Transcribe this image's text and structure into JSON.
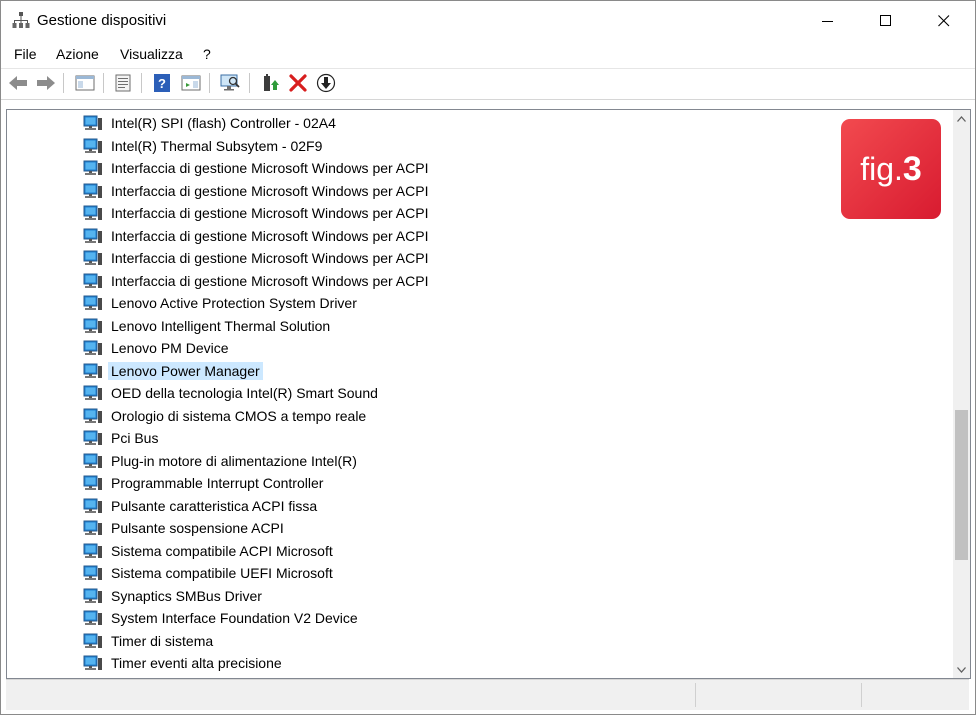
{
  "window": {
    "title": "Gestione dispositivi",
    "controls": [
      "minimize",
      "maximize",
      "close"
    ]
  },
  "menu": [
    {
      "label": "File"
    },
    {
      "label": "Azione"
    },
    {
      "label": "Visualizza"
    },
    {
      "label": "?"
    }
  ],
  "toolbar": {
    "buttons": [
      "back-icon",
      "forward-icon",
      "show-hide-console-tree-icon",
      "properties-icon",
      "help-icon",
      "action-pane-icon",
      "scan-hardware-icon",
      "update-driver-icon",
      "uninstall-icon",
      "disable-device-icon"
    ]
  },
  "tree": {
    "items": [
      {
        "label": "Intel(R) SPI (flash) Controller - 02A4"
      },
      {
        "label": "Intel(R) Thermal Subsytem - 02F9"
      },
      {
        "label": "Interfaccia di gestione Microsoft Windows per ACPI"
      },
      {
        "label": "Interfaccia di gestione Microsoft Windows per ACPI"
      },
      {
        "label": "Interfaccia di gestione Microsoft Windows per ACPI"
      },
      {
        "label": "Interfaccia di gestione Microsoft Windows per ACPI"
      },
      {
        "label": "Interfaccia di gestione Microsoft Windows per ACPI"
      },
      {
        "label": "Interfaccia di gestione Microsoft Windows per ACPI"
      },
      {
        "label": "Lenovo Active Protection System Driver"
      },
      {
        "label": "Lenovo Intelligent Thermal Solution"
      },
      {
        "label": "Lenovo PM Device"
      },
      {
        "label": "Lenovo Power Manager",
        "selected": true
      },
      {
        "label": "OED della tecnologia Intel(R) Smart Sound"
      },
      {
        "label": "Orologio di sistema CMOS a tempo reale"
      },
      {
        "label": "Pci Bus"
      },
      {
        "label": "Plug-in motore di alimentazione Intel(R)"
      },
      {
        "label": "Programmable Interrupt Controller"
      },
      {
        "label": "Pulsante caratteristica ACPI fissa"
      },
      {
        "label": "Pulsante sospensione ACPI"
      },
      {
        "label": "Sistema compatibile ACPI Microsoft"
      },
      {
        "label": "Sistema compatibile UEFI Microsoft"
      },
      {
        "label": "Synaptics SMBus Driver"
      },
      {
        "label": "System Interface Foundation V2 Device"
      },
      {
        "label": "Timer di sistema"
      },
      {
        "label": "Timer eventi alta precisione"
      }
    ]
  },
  "badge": {
    "prefix": "fig.",
    "number": "3"
  },
  "colors": {
    "selection": "#cce8ff",
    "badge": "#e8213a"
  }
}
